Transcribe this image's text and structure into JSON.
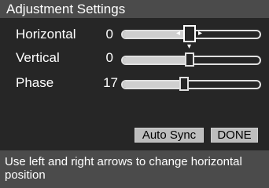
{
  "title": "Adjustment Settings",
  "settings": {
    "items": [
      {
        "label": "Horizontal",
        "value": "0",
        "level": 0.5
      },
      {
        "label": "Vertical",
        "value": "0",
        "level": 0.5
      },
      {
        "label": "Phase",
        "value": "17",
        "level": 0.46
      }
    ]
  },
  "buttons": {
    "auto_sync": "Auto Sync",
    "done": "DONE"
  },
  "help_text": "Use left and right arrows to change horizontal position",
  "icons": {
    "left": "arrow-left-icon",
    "right": "arrow-right-icon",
    "down": "arrow-down-icon"
  }
}
